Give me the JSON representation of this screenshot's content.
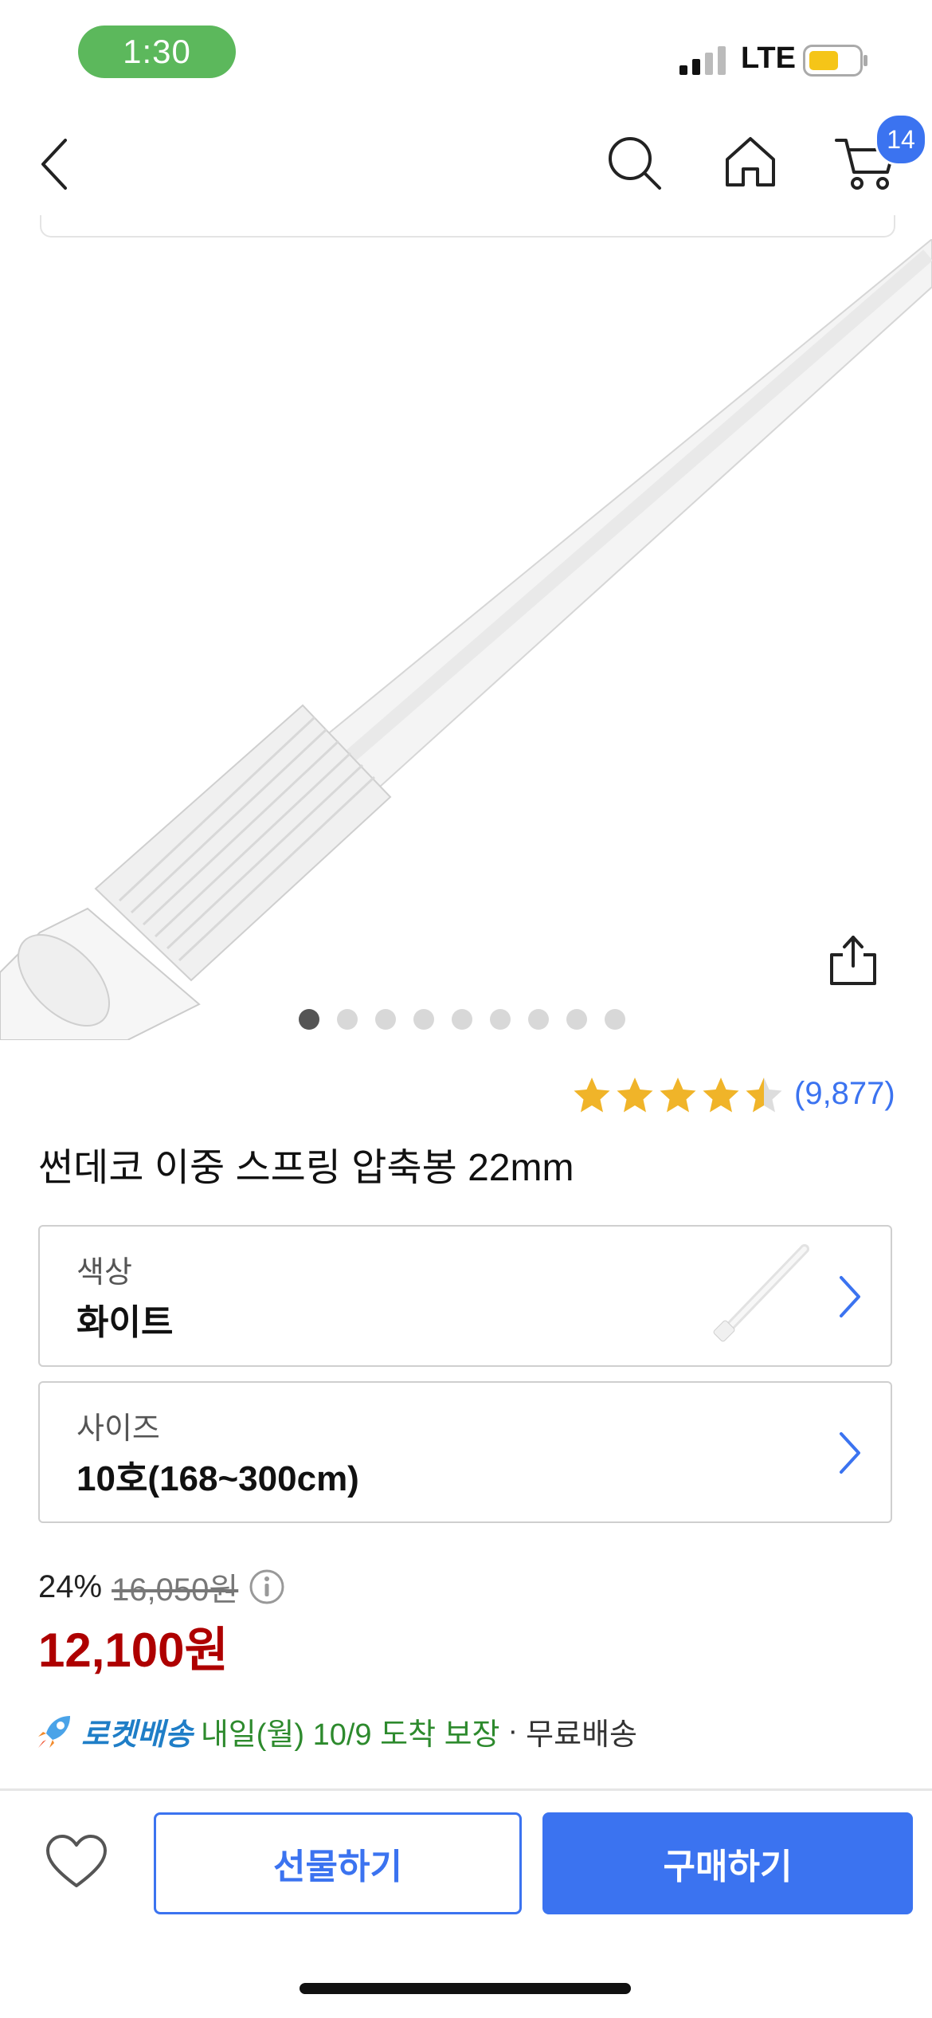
{
  "status_bar": {
    "time": "1:30",
    "network": "LTE"
  },
  "nav": {
    "back_icon": "chevron-left-icon",
    "search_icon": "search-icon",
    "home_icon": "home-icon",
    "cart_icon": "cart-icon",
    "cart_count": "14"
  },
  "product": {
    "image_index": 1,
    "image_total": 9,
    "rating": 4.5,
    "review_count": "(9,877)",
    "title": "썬데코 이중 스프링 압축봉 22mm"
  },
  "options": [
    {
      "label": "색상",
      "value": "화이트"
    },
    {
      "label": "사이즈",
      "value": "10호(168~300cm)"
    }
  ],
  "price": {
    "discount": "24%",
    "original": "16,050원",
    "current": "12,100원"
  },
  "delivery": {
    "rocket_label": "로켓배송",
    "arrival": "내일(월) 10/9 도착 보장",
    "separator": "·",
    "shipping": "무료배송"
  },
  "bottom_bar": {
    "gift_label": "선물하기",
    "buy_label": "구매하기"
  },
  "colors": {
    "accent": "#3b73f0",
    "price_red": "#ae0000",
    "star": "#f0b429",
    "time_pill": "#5cb85c",
    "arrival_green": "#2d8a2d",
    "rocket_blue": "#1f7ec7"
  }
}
